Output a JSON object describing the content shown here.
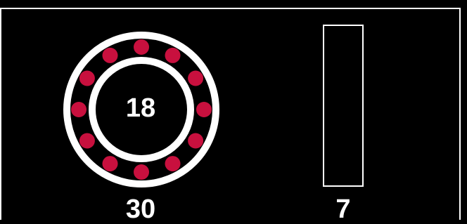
{
  "diagram": {
    "bearing": {
      "inner_diameter": "18",
      "outer_diameter": "30",
      "ball_count": 12
    },
    "side_view": {
      "width": "7"
    }
  },
  "colors": {
    "background": "#000000",
    "line": "#ffffff",
    "ball": "#c8103e"
  }
}
